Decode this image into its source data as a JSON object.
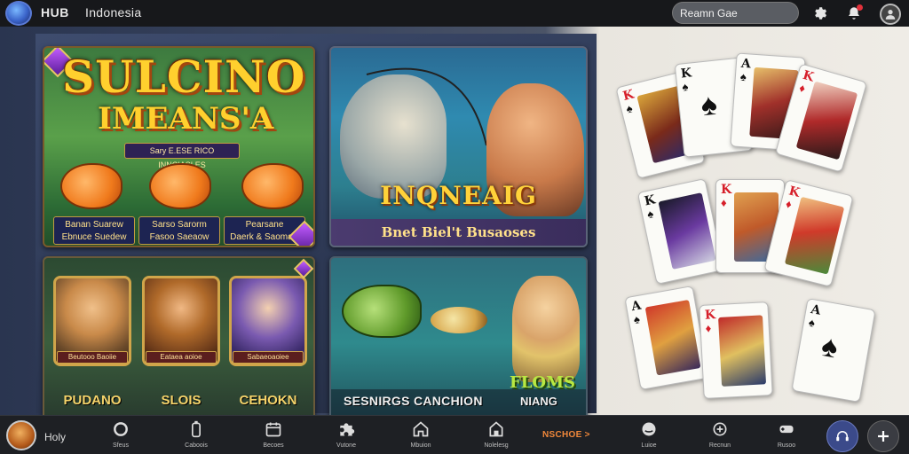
{
  "header": {
    "brand": "HUB",
    "region": "Indonesia",
    "search_placeholder": "Reamn Gae"
  },
  "tiles": {
    "slots": {
      "title_line1": "SULCINO",
      "title_line2": "IMEANS'A",
      "subtitle": "Sary E.ESE RICO INNCIASLES",
      "fish_labels": [
        {
          "top": "Banan Suarew",
          "bottom": "Ebnuce Suedew"
        },
        {
          "top": "Sarso Sarorm",
          "bottom": "Fasoo Saeaow"
        },
        {
          "top": "Pearsane",
          "bottom": "Daerk & Saomaw"
        }
      ]
    },
    "fishing": {
      "title": "INQNEAIG",
      "subtitle": "Bnet Biel't Busaoses"
    },
    "characters": {
      "plates": [
        "Beutooo Baoiie",
        "Eataea aoioe",
        "Sabaeoaoiee"
      ],
      "names": [
        "PUDANO",
        "SLOIS",
        "CEHOKN"
      ]
    },
    "fish_games": {
      "caption_left": "SESNIRGS CANCHION",
      "caption_right_top": "FLOMS",
      "caption_right": "NIANG"
    }
  },
  "bottom_nav": {
    "user_label": "Holy",
    "items": [
      "Sfeus",
      "Caboois",
      "Becoes",
      "Vutone",
      "Mbuion",
      "Nolelesg",
      "Luioe",
      "Recnun",
      "Rusoo"
    ],
    "promo": "NSCHOE >"
  }
}
